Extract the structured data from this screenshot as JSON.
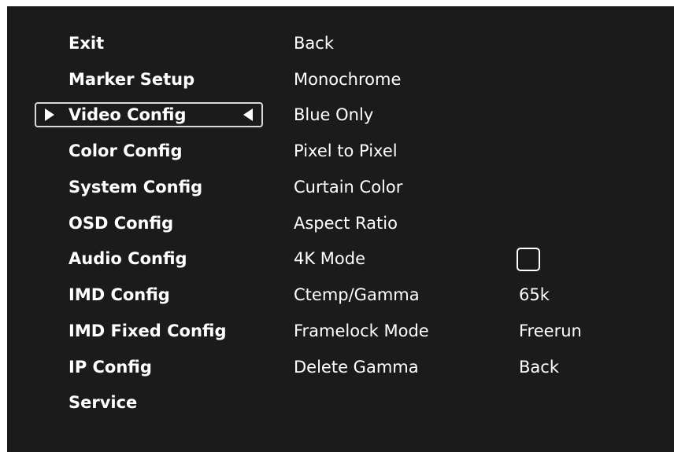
{
  "main_menu": {
    "items": [
      {
        "label": "Exit"
      },
      {
        "label": "Marker Setup"
      },
      {
        "label": "Video Config",
        "selected": true
      },
      {
        "label": "Color Config"
      },
      {
        "label": "System Config"
      },
      {
        "label": "OSD Config"
      },
      {
        "label": "Audio Config"
      },
      {
        "label": "IMD Config"
      },
      {
        "label": "IMD Fixed Config"
      },
      {
        "label": "IP Config"
      },
      {
        "label": "Service"
      }
    ]
  },
  "submenu": {
    "items": [
      {
        "label": "Back"
      },
      {
        "label": "Monochrome"
      },
      {
        "label": "Blue Only"
      },
      {
        "label": "Pixel to Pixel"
      },
      {
        "label": "Curtain Color"
      },
      {
        "label": "Aspect Ratio"
      },
      {
        "label": "4K Mode"
      },
      {
        "label": "Ctemp/Gamma"
      },
      {
        "label": "Framelock Mode"
      },
      {
        "label": "Delete Gamma"
      }
    ]
  },
  "values": {
    "mode_4k_checked": false,
    "ctemp_gamma": "65k",
    "framelock_mode": "Freerun",
    "delete_gamma": "Back"
  },
  "colors": {
    "background": "#1b1b1b",
    "text": "#ffffff",
    "selection_border": "#d9d9d9"
  }
}
